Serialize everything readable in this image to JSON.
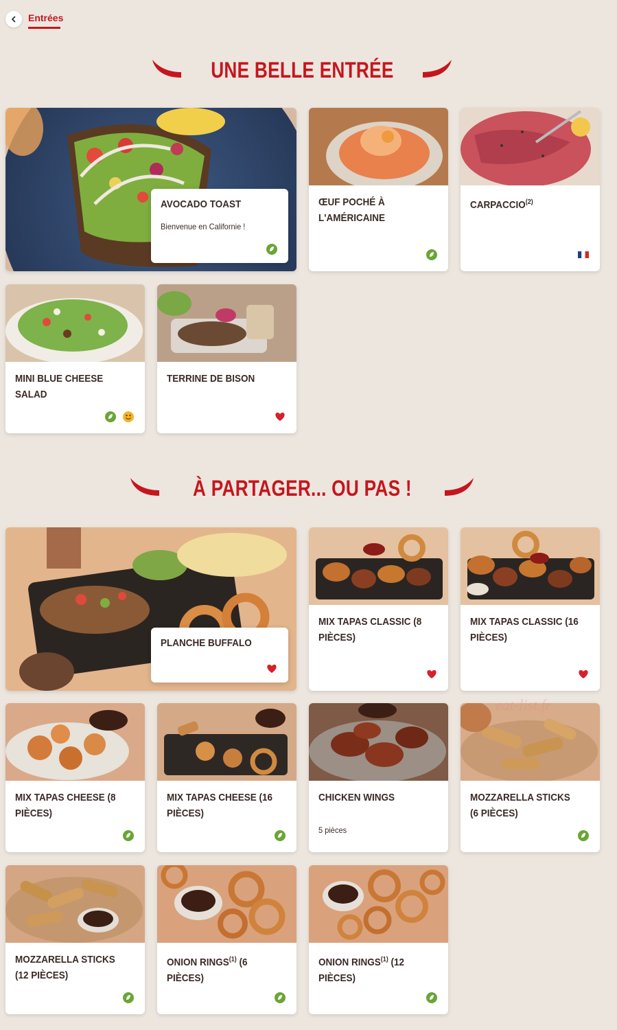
{
  "nav": {
    "back_label": "‹",
    "breadcrumb": "Entrées"
  },
  "colors": {
    "brand_red": "#c5161d",
    "background": "#ece6df",
    "veggie_green": "#6aa536",
    "heart_red": "#d6202a"
  },
  "section1": {
    "title": "UNE BELLE ENTRÉE",
    "featured": {
      "name": "AVOCADO TOAST",
      "desc": "Bienvenue en Californie !",
      "tags": [
        "veggie-icon"
      ]
    },
    "items": [
      {
        "name": "ŒUF POCHÉ À L'AMÉRICAINE",
        "desc": "",
        "tags": [
          "veggie-icon"
        ]
      },
      {
        "name": "CARPACCIO",
        "sup": "(2)",
        "desc": "",
        "tags": [
          "french-flag-icon"
        ]
      },
      {
        "name": "MINI BLUE CHEESE SALAD",
        "desc": "",
        "tags": [
          "veggie-icon",
          "smiley-icon"
        ]
      },
      {
        "name": "TERRINE DE BISON",
        "desc": "",
        "tags": [
          "heart-icon"
        ]
      }
    ]
  },
  "section2": {
    "title": "À PARTAGER... OU PAS !",
    "featured": {
      "name": "PLANCHE BUFFALO",
      "desc": "",
      "tags": [
        "heart-icon"
      ]
    },
    "items": [
      {
        "name": "MIX TAPAS CLASSIC (8 PIÈCES)",
        "desc": "",
        "tags": [
          "heart-icon"
        ]
      },
      {
        "name": "MIX TAPAS CLASSIC (16 PIÈCES)",
        "desc": "",
        "tags": [
          "heart-icon"
        ]
      },
      {
        "name": "MIX TAPAS CHEESE (8 PIÈCES)",
        "desc": "",
        "tags": [
          "veggie-icon"
        ]
      },
      {
        "name": "MIX TAPAS CHEESE (16 PIÈCES)",
        "desc": "",
        "tags": [
          "veggie-icon"
        ]
      },
      {
        "name": "CHICKEN WINGS",
        "desc": "5 pièces",
        "tags": []
      },
      {
        "name": "MOZZARELLA STICKS (6 PIÈCES)",
        "desc": "",
        "tags": [
          "veggie-icon"
        ]
      },
      {
        "name": "MOZZARELLA STICKS (12 PIÈCES)",
        "desc": "",
        "tags": [
          "veggie-icon"
        ]
      },
      {
        "name": "ONION RINGS",
        "sup": "(1)",
        "name_suffix": " (6 PIÈCES)",
        "desc": "",
        "tags": [
          "veggie-icon"
        ]
      },
      {
        "name": "ONION RINGS",
        "sup": "(1)",
        "name_suffix": " (12 PIÈCES)",
        "desc": "",
        "tags": [
          "veggie-icon"
        ]
      }
    ]
  },
  "watermark": "eat-list.fr"
}
